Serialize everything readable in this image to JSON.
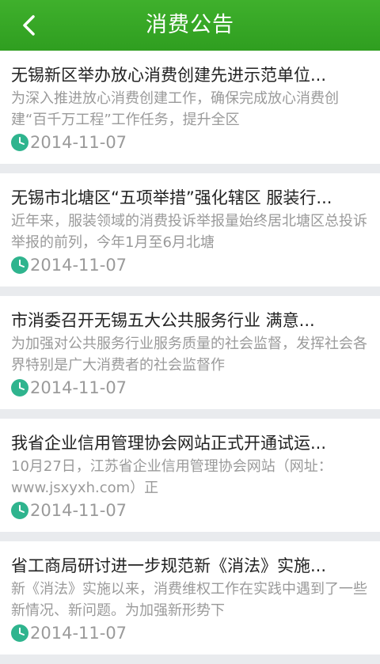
{
  "header": {
    "title": "消费公告",
    "back_icon": "chevron-left-icon",
    "accent_color": "#35a526"
  },
  "list": {
    "items": [
      {
        "title": "无锡新区举办放心消费创建先进示范单位...",
        "summary": "为深入推进放心消费创建工作，确保完成放心消费创建“百千万工程”工作任务，提升全区",
        "date": "2014-11-07"
      },
      {
        "title": "无锡市北塘区“五项举措”强化辖区 服装行...",
        "summary": "近年来，服装领域的消费投诉举报量始终居北塘区总投诉举报的前列，今年1月至6月北塘",
        "date": "2014-11-07"
      },
      {
        "title": "市消委召开无锡五大公共服务行业 满意...",
        "summary": "为加强对公共服务行业服务质量的社会监督，发挥社会各界特别是广大消费者的社会监督作",
        "date": "2014-11-07"
      },
      {
        "title": "我省企业信用管理协会网站正式开通试运...",
        "summary": "10月27日，江苏省企业信用管理协会网站（网址：www.jsxyxh.com）正",
        "date": "2014-11-07"
      },
      {
        "title": "省工商局研讨进一步规范新《消法》实施...",
        "summary": "新《消法》实施以来，消费维权工作在实践中遇到了一些新情况、新问题。为加强新形势下",
        "date": "2014-11-07"
      }
    ],
    "date_icon": "clock-icon",
    "date_icon_color": "#2fb48e"
  }
}
